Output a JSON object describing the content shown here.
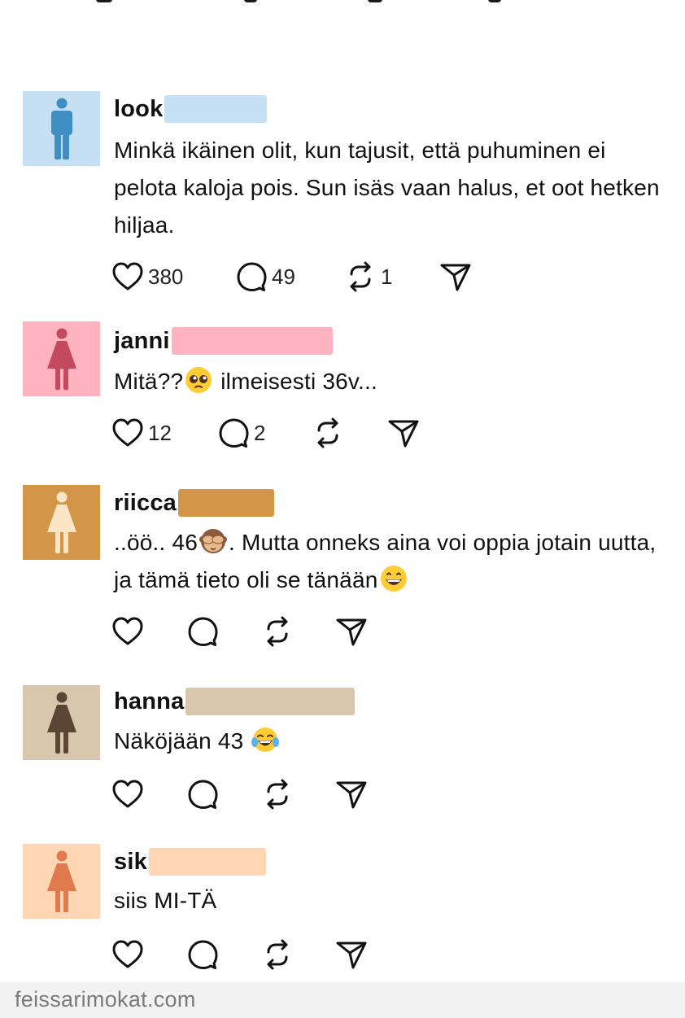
{
  "colors": {
    "avatar_blue": "#c5e0f2",
    "avatar_pink": "#ffb3be",
    "avatar_ochre": "#d39548",
    "avatar_tan": "#d8c7ad",
    "avatar_peach": "#ffd6b3"
  },
  "comments": [
    {
      "username": "look",
      "avatar_icon": "man-icon",
      "text": "Minkä ikäinen olit, kun tajusit, että puhuminen ei pelota kaloja pois. Sun isäs vaan halus, et oot hetken hiljaa.",
      "likes": "380",
      "replies": "49",
      "reposts": "1"
    },
    {
      "username": "janni",
      "avatar_icon": "woman-icon",
      "text_before": "Mitä??",
      "emoji": "pleading-face-emoji",
      "text_after": " ilmeisesti 36v...",
      "likes": "12",
      "replies": "2"
    },
    {
      "username": "riicca",
      "avatar_icon": "woman-icon",
      "text_before": "..öö.. 46",
      "emoji": "see-no-evil-monkey-emoji",
      "text_middle": ". Mutta onneks aina voi oppia jotain uutta, ja tämä tieto oli se tänään",
      "emoji2": "grinning-face-emoji"
    },
    {
      "username": "hanna",
      "avatar_icon": "woman-icon",
      "text_before": "Näköjään 43 ",
      "emoji": "tears-of-joy-emoji"
    },
    {
      "username": "sik",
      "avatar_icon": "woman-icon",
      "text": "siis MI-TÄ"
    }
  ],
  "footer": {
    "watermark": "feissarimokat.com"
  }
}
